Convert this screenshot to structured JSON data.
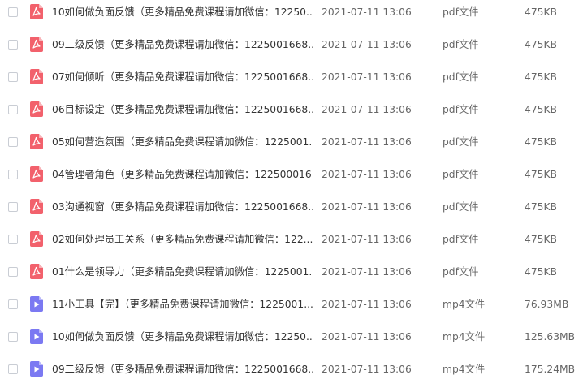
{
  "colors": {
    "pdf_icon": "#f2616c",
    "video_icon": "#7b79f2",
    "text_primary": "#333333",
    "text_secondary": "#666666"
  },
  "files": [
    {
      "name": "10如何做负面反馈（更多精品免费课程请加微信：12250...",
      "date": "2021-07-11 13:06",
      "type": "pdf文件",
      "size": "475KB",
      "icon": "pdf-icon"
    },
    {
      "name": "09二级反馈（更多精品免费课程请加微信：1225001668...",
      "date": "2021-07-11 13:06",
      "type": "pdf文件",
      "size": "475KB",
      "icon": "pdf-icon"
    },
    {
      "name": "07如何倾听（更多精品免费课程请加微信：1225001668...",
      "date": "2021-07-11 13:06",
      "type": "pdf文件",
      "size": "475KB",
      "icon": "pdf-icon"
    },
    {
      "name": "06目标设定（更多精品免费课程请加微信：1225001668...",
      "date": "2021-07-11 13:06",
      "type": "pdf文件",
      "size": "475KB",
      "icon": "pdf-icon"
    },
    {
      "name": "05如何营造氛围（更多精品免费课程请加微信：1225001...",
      "date": "2021-07-11 13:06",
      "type": "pdf文件",
      "size": "475KB",
      "icon": "pdf-icon"
    },
    {
      "name": "04管理者角色（更多精品免费课程请加微信：122500016...",
      "date": "2021-07-11 13:06",
      "type": "pdf文件",
      "size": "475KB",
      "icon": "pdf-icon"
    },
    {
      "name": "03沟通视窗（更多精品免费课程请加微信：1225001668...",
      "date": "2021-07-11 13:06",
      "type": "pdf文件",
      "size": "475KB",
      "icon": "pdf-icon"
    },
    {
      "name": "02如何处理员工关系（更多精品免费课程请加微信：122...",
      "date": "2021-07-11 13:06",
      "type": "pdf文件",
      "size": "475KB",
      "icon": "pdf-icon"
    },
    {
      "name": "01什么是领导力（更多精品免费课程请加微信：1225001...",
      "date": "2021-07-11 13:06",
      "type": "pdf文件",
      "size": "475KB",
      "icon": "pdf-icon"
    },
    {
      "name": "11小工具【完】（更多精品免费课程请加微信：1225001...",
      "date": "2021-07-11 13:06",
      "type": "mp4文件",
      "size": "76.93MB",
      "icon": "video-icon"
    },
    {
      "name": "10如何做负面反馈（更多精品免费课程请加微信：12250...",
      "date": "2021-07-11 13:06",
      "type": "mp4文件",
      "size": "125.63MB",
      "icon": "video-icon"
    },
    {
      "name": "09二级反馈（更多精品免费课程请加微信：1225001668...",
      "date": "2021-07-11 13:06",
      "type": "mp4文件",
      "size": "175.24MB",
      "icon": "video-icon"
    }
  ]
}
